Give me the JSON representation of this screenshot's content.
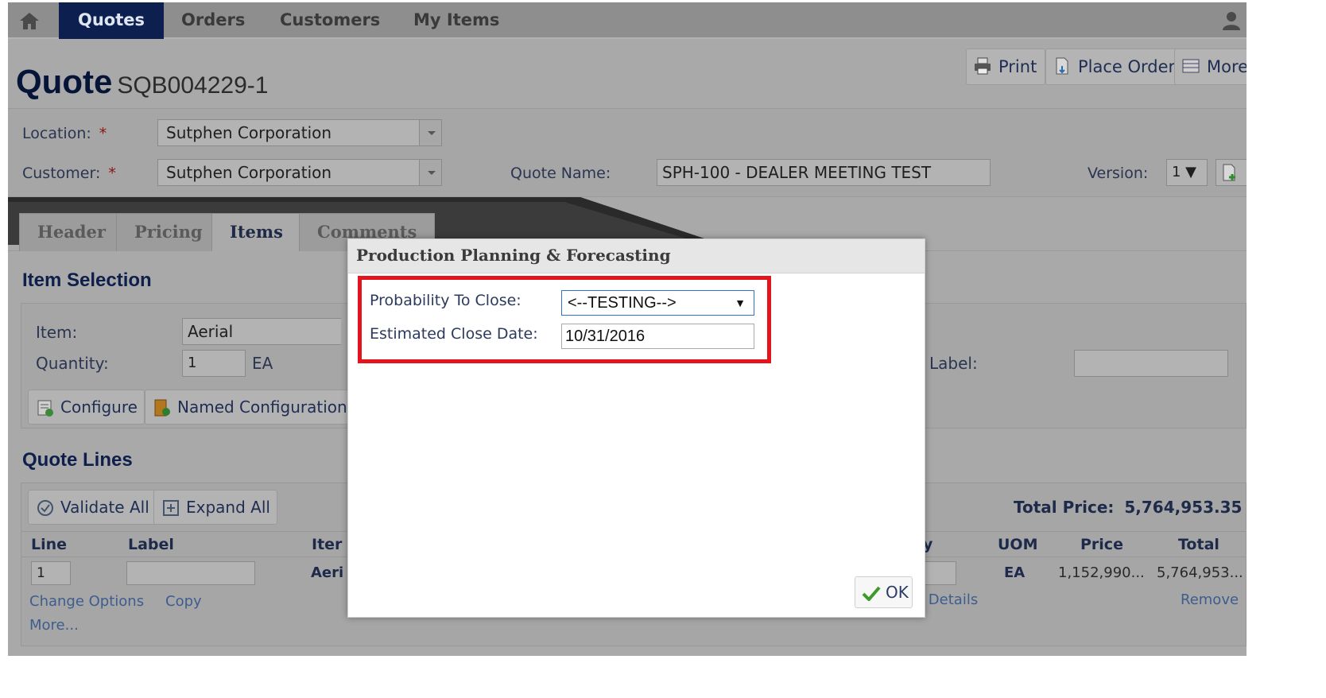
{
  "nav": {
    "tabs": [
      "Quotes",
      "Orders",
      "Customers",
      "My Items"
    ],
    "home_icon": "home-icon",
    "user_icon": "user-icon"
  },
  "header": {
    "title": "Quote",
    "quote_number": "SQB004229-1",
    "actions": {
      "print": "Print",
      "place_order": "Place Order",
      "more": "More"
    }
  },
  "form": {
    "location_label": "Location:",
    "location_value": "Sutphen Corporation",
    "customer_label": "Customer:",
    "customer_value": "Sutphen Corporation",
    "required_mark": "*",
    "quote_name_label": "Quote Name:",
    "quote_name_value": "SPH-100 - DEALER MEETING TEST",
    "version_label": "Version:",
    "version_value": "1 ▼"
  },
  "tabs": [
    "Header",
    "Pricing",
    "Items",
    "Comments"
  ],
  "item_selection": {
    "heading": "Item Selection",
    "item_label": "Item:",
    "item_value": "Aerial",
    "quantity_label": "Quantity:",
    "quantity_value": "1",
    "unit": "EA",
    "label_label": "Label:",
    "configure": "Configure",
    "named_configuration": "Named Configuration"
  },
  "quote_lines": {
    "heading": "Quote Lines",
    "validate_all": "Validate All",
    "expand_all": "Expand All",
    "total_price_label": "Total Price:",
    "total_price_value": "5,764,953.35",
    "columns": {
      "line": "Line",
      "label": "Label",
      "item": "Iter",
      "qty": "y",
      "uom": "UOM",
      "price": "Price",
      "total": "Total"
    },
    "row": {
      "line": "1",
      "item": "Aeri",
      "uom": "EA",
      "price": "1,152,990...",
      "total": "5,764,953..."
    },
    "links": {
      "change_options": "Change Options",
      "copy": "Copy",
      "more": "More...",
      "details": "e Details",
      "remove": "Remove"
    }
  },
  "modal": {
    "title": "Production Planning & Forecasting",
    "probability_label": "Probability To Close:",
    "probability_value": "<--TESTING-->",
    "close_date_label": "Estimated Close Date:",
    "close_date_value": "10/31/2016",
    "ok": "OK",
    "highlight_color": "#e3141b"
  }
}
